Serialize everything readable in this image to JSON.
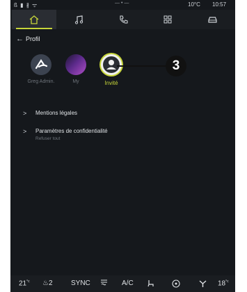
{
  "status_bar": {
    "left_icons": "ß ▮ ∦ ᯤ",
    "center": "— • —",
    "temperature": "10°C",
    "time": "10:57"
  },
  "tabs": [
    {
      "icon": "home-icon",
      "active": true
    },
    {
      "icon": "music-icon",
      "active": false
    },
    {
      "icon": "phone-icon",
      "active": false
    },
    {
      "icon": "apps-icon",
      "active": false
    },
    {
      "icon": "car-icon",
      "active": false
    }
  ],
  "header": {
    "back_icon": "←",
    "title": "Profil"
  },
  "profiles": [
    {
      "name": "Greg Admin.",
      "icon": "alpine-logo-icon",
      "active": false
    },
    {
      "name": "My",
      "icon": "purple-avatar-icon",
      "active": false
    },
    {
      "name": "Invité",
      "icon": "guest-user-icon",
      "active": true
    }
  ],
  "callout": {
    "label": "3"
  },
  "menu": [
    {
      "chevron": ">",
      "label": "Mentions légales",
      "sublabel": ""
    },
    {
      "chevron": ">",
      "label": "Paramètres de confidentialité",
      "sublabel": "Refuser tout"
    }
  ],
  "bottom_bar": {
    "left_temp": "21",
    "left_temp_unit": "°c",
    "seat_heat_level": "2",
    "sync_label": "SYNC",
    "ac_label": "A/C",
    "right_temp": "18",
    "right_temp_unit": "°c"
  },
  "colors": {
    "accent": "#c7d63a",
    "background": "#15181c"
  }
}
